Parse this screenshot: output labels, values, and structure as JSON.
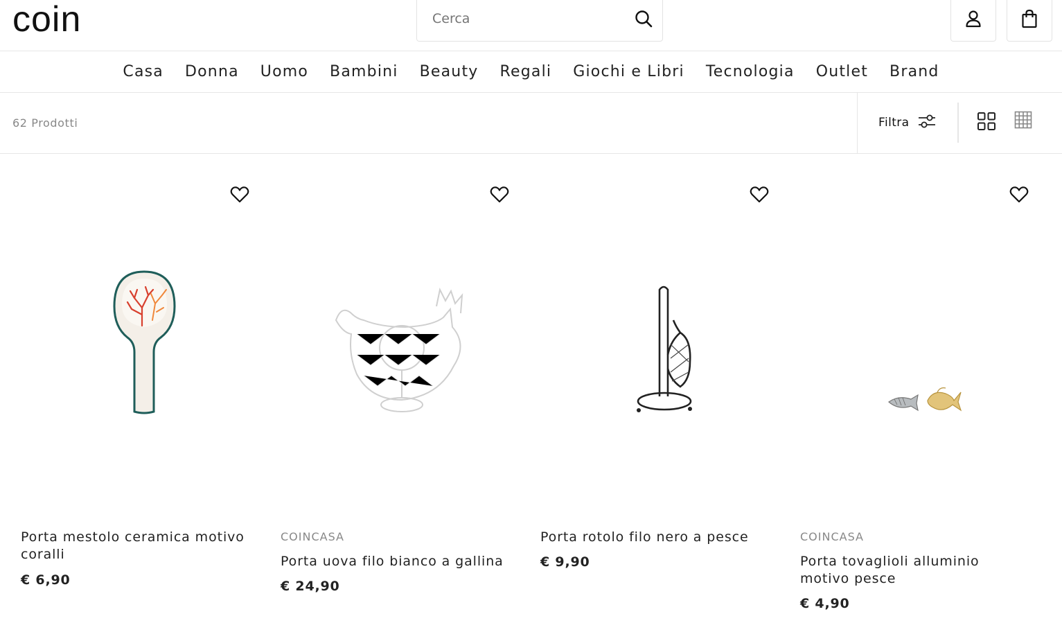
{
  "header": {
    "logo": "coin",
    "search_placeholder": "Cerca"
  },
  "nav": {
    "items": [
      "Casa",
      "Donna",
      "Uomo",
      "Bambini",
      "Beauty",
      "Regali",
      "Giochi e Libri",
      "Tecnologia",
      "Outlet",
      "Brand"
    ]
  },
  "toolbar": {
    "count": "62 Prodotti",
    "filter_label": "Filtra"
  },
  "products": [
    {
      "brand": "",
      "title": "Porta mestolo ceramica motivo coralli",
      "price": "€ 6,90"
    },
    {
      "brand": "COINCASA",
      "title": "Porta uova filo bianco a gallina",
      "price": "€ 24,90"
    },
    {
      "brand": "",
      "title": "Porta rotolo filo nero a pesce",
      "price": "€ 9,90"
    },
    {
      "brand": "COINCASA",
      "title": "Porta tovaglioli alluminio motivo pesce",
      "price": "€ 4,90"
    }
  ],
  "icons": {
    "search": "search-icon",
    "account": "user-icon",
    "bag": "shopping-bag-icon",
    "filter": "sliders-icon",
    "grid2": "grid-2x2-icon",
    "grid4": "grid-4x4-icon",
    "wishlist": "heart-icon"
  }
}
